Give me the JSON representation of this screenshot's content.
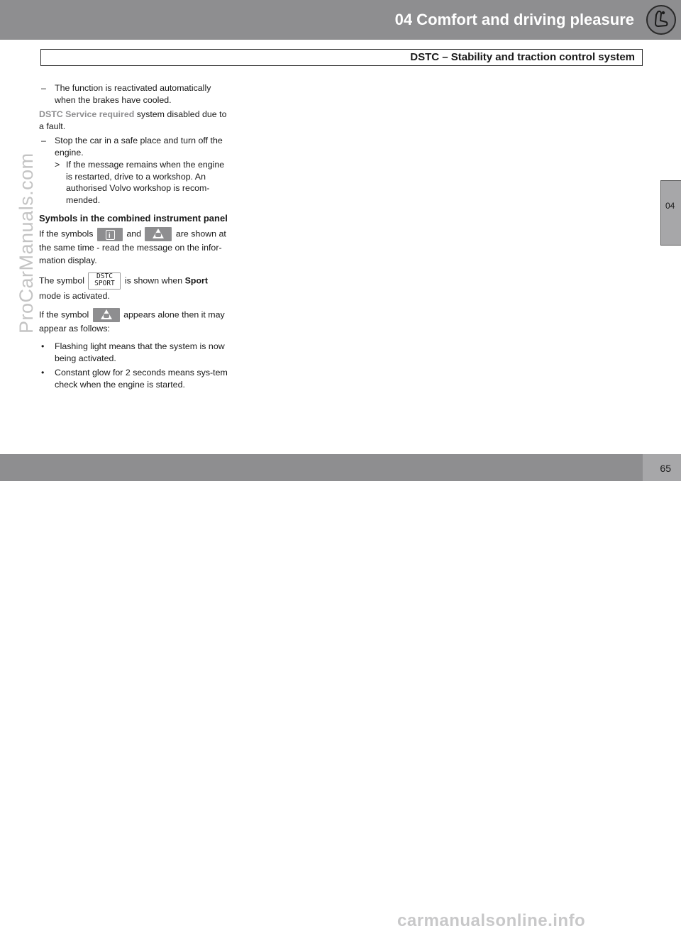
{
  "header": {
    "chapter_title": "04 Comfort and driving pleasure",
    "chapter_icon": "seat-icon",
    "section_title": "DSTC – Stability and traction control system"
  },
  "side_tab": {
    "label": "04"
  },
  "footer": {
    "page_number": "65"
  },
  "watermarks": {
    "left": "ProCarManuals.com",
    "bottom": "carmanualsonline.info"
  },
  "content": {
    "item1": {
      "marker": "–",
      "text": "The function is reactivated automatically when the brakes have cooled."
    },
    "msg_para": {
      "message": "DSTC Service required",
      "text": " system disabled due to a fault."
    },
    "item2": {
      "marker": "–",
      "text": "Stop the car in a safe place and turn off the engine."
    },
    "item2_sub": {
      "marker": ">",
      "text": "If the message remains when the engine is restarted, drive to a workshop. An authorised Volvo workshop is recom-mended."
    },
    "heading": "Symbols in the combined instrument panel",
    "para1": {
      "before": "If the symbols ",
      "between": " and ",
      "after": " are shown at the same time - read the message on the infor-mation display."
    },
    "para2": {
      "before": "The symbol ",
      "symbol_line1": "DSTC",
      "symbol_line2": "SPORT",
      "middle": " is shown when ",
      "bold": "Sport",
      "after": " mode is activated."
    },
    "para3": {
      "before": "If the symbol ",
      "after": " appears alone then it may appear as follows:"
    },
    "bullets": [
      {
        "marker": "•",
        "text": "Flashing light means that the system is now being activated."
      },
      {
        "marker": "•",
        "text": "Constant glow for 2 seconds means sys-tem check when the engine is started."
      }
    ],
    "icons": {
      "info_symbol": "information-icon",
      "skid_symbol": "skid-warning-icon"
    },
    "colors": {
      "message_gray": "#8e8e90",
      "band_gray": "#8e8e90"
    }
  }
}
